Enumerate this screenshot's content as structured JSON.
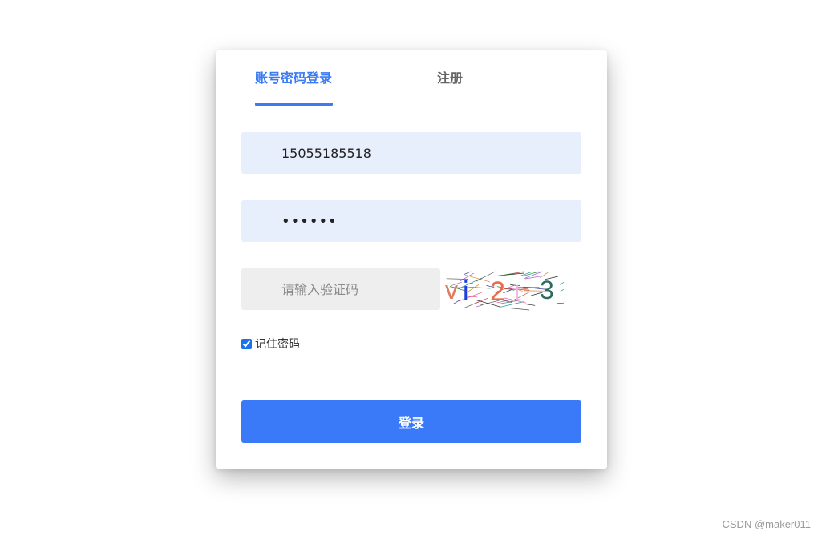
{
  "tabs": {
    "login_label": "账号密码登录",
    "register_label": "注册",
    "active": "login"
  },
  "form": {
    "phone_value": "15055185518",
    "password_value": "••••••",
    "captcha_placeholder": "请输入验证码",
    "captcha_text": [
      "v",
      "i",
      "2",
      "t",
      "3"
    ],
    "captcha_colors": [
      "#e07a5f",
      "#1e3fe0",
      "#ea6a4a",
      "#f0b6e6",
      "#2e6a5e"
    ],
    "remember_label": "记住密码",
    "remember_checked": true,
    "login_button_label": "登录"
  },
  "colors": {
    "accent": "#3a7af4",
    "input_bg": "#e8effc",
    "captcha_input_bg": "#eeeeee"
  },
  "watermark": "CSDN @maker011"
}
